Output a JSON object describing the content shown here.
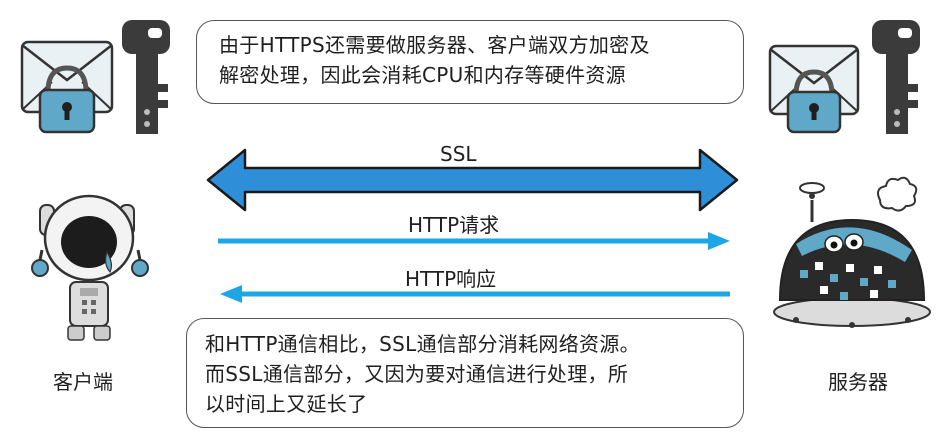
{
  "top_note": {
    "line1": "由于HTTPS还需要做服务器、客户端双方加密及",
    "line2": "解密处理，因此会消耗CPU和内存等硬件资源"
  },
  "arrows": {
    "ssl": "SSL",
    "request": "HTTP请求",
    "response": "HTTP响应"
  },
  "bottom_note": {
    "line1": "和HTTP通信相比，SSL通信部分消耗网络资源。",
    "line2": "而SSL通信部分，又因为要对通信进行处理，所",
    "line3": "以时间上又延长了"
  },
  "nodes": {
    "client": "客户端",
    "server": "服务器"
  },
  "colors": {
    "ssl_arrow": "#2e8fd8",
    "http_arrow": "#1ea6e4",
    "lock_body": "#5fa8c8",
    "key": "#3b3b3b"
  }
}
